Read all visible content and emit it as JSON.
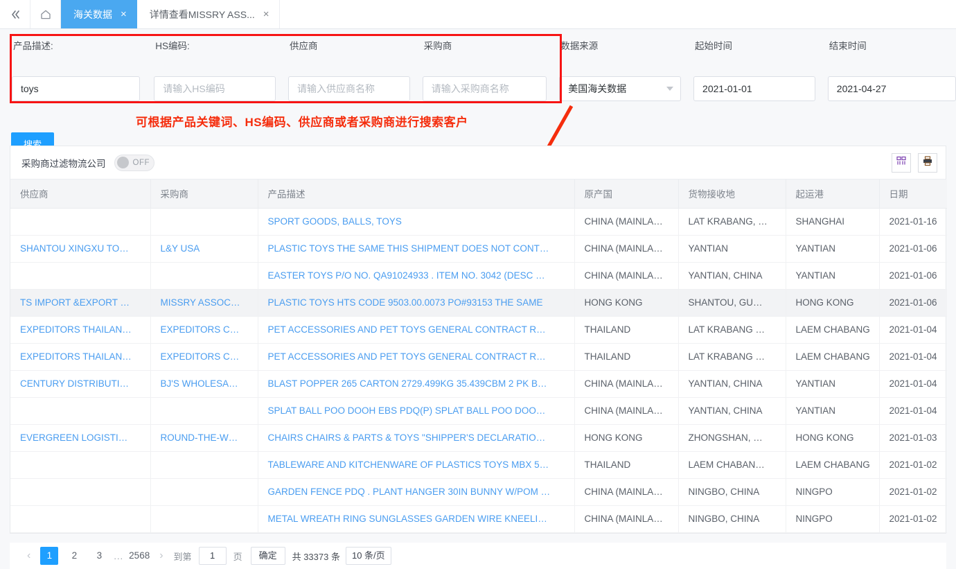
{
  "tabbar": {
    "collapse_icon": "double-chevron-left-icon",
    "home_icon": "home-icon",
    "tabs": [
      {
        "label": "海关数据",
        "close": "×",
        "active": true
      },
      {
        "label": "详情查看MISSRY ASS...",
        "close": "×",
        "active": false
      }
    ]
  },
  "search": {
    "fields": [
      {
        "label": "产品描述:",
        "value": "toys",
        "placeholder": ""
      },
      {
        "label": "HS编码:",
        "value": "",
        "placeholder": "请输入HS编码"
      },
      {
        "label": "供应商",
        "value": "",
        "placeholder": "请输入供应商名称"
      },
      {
        "label": "采购商",
        "value": "",
        "placeholder": "请输入采购商名称"
      },
      {
        "label": "数据来源",
        "value": "美国海关数据",
        "placeholder": ""
      },
      {
        "label": "起始时间",
        "value": "2021-01-01",
        "placeholder": ""
      },
      {
        "label": "结束时间",
        "value": "2021-04-27",
        "placeholder": ""
      }
    ],
    "button_label": "搜索"
  },
  "annotation": {
    "note": "可根据产品关键词、HS编码、供应商或者采购商进行搜索客户",
    "color": "#f52d0d"
  },
  "toolbar": {
    "filter_label": "采购商过滤物流公司",
    "toggle_state": "OFF",
    "columns_icon": "columns-settings-icon",
    "export_icon": "export-printer-icon"
  },
  "table": {
    "columns": [
      "供应商",
      "采购商",
      "产品描述",
      "原产国",
      "货物接收地",
      "起运港",
      "日期"
    ],
    "rows": [
      {
        "supplier": "",
        "buyer": "",
        "desc": "SPORT GOODS, BALLS, TOYS",
        "origin": "CHINA (MAINLA…",
        "receipt": "LAT KRABANG, …",
        "port": "SHANGHAI",
        "date": "2021-01-16",
        "hover": false
      },
      {
        "supplier": "SHANTOU XINGXU TO…",
        "buyer": "L&Y USA",
        "desc": "PLASTIC TOYS THE SAME THIS SHIPMENT DOES NOT CONT…",
        "origin": "CHINA (MAINLA…",
        "receipt": "YANTIAN",
        "port": "YANTIAN",
        "date": "2021-01-06",
        "hover": false
      },
      {
        "supplier": "",
        "buyer": "",
        "desc": "EASTER TOYS P/O NO. QA91024933 . ITEM NO. 3042 (DESC …",
        "origin": "CHINA (MAINLA…",
        "receipt": "YANTIAN, CHINA",
        "port": "YANTIAN",
        "date": "2021-01-06",
        "hover": false
      },
      {
        "supplier": "TS IMPORT &EXPORT …",
        "buyer": "MISSRY ASSOC…",
        "desc": "PLASTIC TOYS HTS CODE 9503.00.0073 PO#93153 THE SAME",
        "origin": "HONG KONG",
        "receipt": "SHANTOU, GU…",
        "port": "HONG KONG",
        "date": "2021-01-06",
        "hover": true
      },
      {
        "supplier": "EXPEDITORS THAILAN…",
        "buyer": "EXPEDITORS C…",
        "desc": "PET ACCESSORIES AND PET TOYS GENERAL CONTRACT R…",
        "origin": "THAILAND",
        "receipt": "LAT KRABANG …",
        "port": "LAEM CHABANG",
        "date": "2021-01-04",
        "hover": false
      },
      {
        "supplier": "EXPEDITORS THAILAN…",
        "buyer": "EXPEDITORS C…",
        "desc": "PET ACCESSORIES AND PET TOYS GENERAL CONTRACT R…",
        "origin": "THAILAND",
        "receipt": "LAT KRABANG …",
        "port": "LAEM CHABANG",
        "date": "2021-01-04",
        "hover": false
      },
      {
        "supplier": "CENTURY DISTRIBUTI…",
        "buyer": "BJ'S WHOLESA…",
        "desc": "BLAST POPPER 265 CARTON 2729.499KG 35.439CBM 2 PK B…",
        "origin": "CHINA (MAINLA…",
        "receipt": "YANTIAN, CHINA",
        "port": "YANTIAN",
        "date": "2021-01-04",
        "hover": false
      },
      {
        "supplier": "",
        "buyer": "",
        "desc": "SPLAT BALL POO DOOH EBS PDQ(P) SPLAT BALL POO DOO…",
        "origin": "CHINA (MAINLA…",
        "receipt": "YANTIAN, CHINA",
        "port": "YANTIAN",
        "date": "2021-01-04",
        "hover": false
      },
      {
        "supplier": "EVERGREEN LOGISTI…",
        "buyer": "ROUND-THE-W…",
        "desc": "CHAIRS CHAIRS & PARTS & TOYS \"SHIPPER'S DECLARATIO…",
        "origin": "HONG KONG",
        "receipt": "ZHONGSHAN, …",
        "port": "HONG KONG",
        "date": "2021-01-03",
        "hover": false
      },
      {
        "supplier": "",
        "buyer": "",
        "desc": "TABLEWARE AND KITCHENWARE OF PLASTICS TOYS MBX 5…",
        "origin": "THAILAND",
        "receipt": "LAEM CHABAN…",
        "port": "LAEM CHABANG",
        "date": "2021-01-02",
        "hover": false
      },
      {
        "supplier": "",
        "buyer": "",
        "desc": "GARDEN FENCE PDQ . PLANT HANGER 30IN BUNNY W/POM …",
        "origin": "CHINA (MAINLA…",
        "receipt": "NINGBO, CHINA",
        "port": "NINGPO",
        "date": "2021-01-02",
        "hover": false
      },
      {
        "supplier": "",
        "buyer": "",
        "desc": "METAL WREATH RING SUNGLASSES GARDEN WIRE KNEELI…",
        "origin": "CHINA (MAINLA…",
        "receipt": "NINGBO, CHINA",
        "port": "NINGPO",
        "date": "2021-01-02",
        "hover": false
      }
    ]
  },
  "pagination": {
    "prev_icon": "chevron-left-icon",
    "next_icon": "chevron-right-icon",
    "pages": [
      "1",
      "2",
      "3"
    ],
    "ellipsis": "...",
    "last_page": "2568",
    "current_page": "1",
    "jump_prefix": "到第",
    "jump_value": "1",
    "jump_suffix": "页",
    "confirm_label": "确定",
    "total_label": "共 33373 条",
    "page_size_label": "10 条/页"
  },
  "colors": {
    "accent": "#1e9fff",
    "tab_active": "#4aa8f0",
    "link": "#4a9df0",
    "annotation_red": "#f52d0d"
  }
}
